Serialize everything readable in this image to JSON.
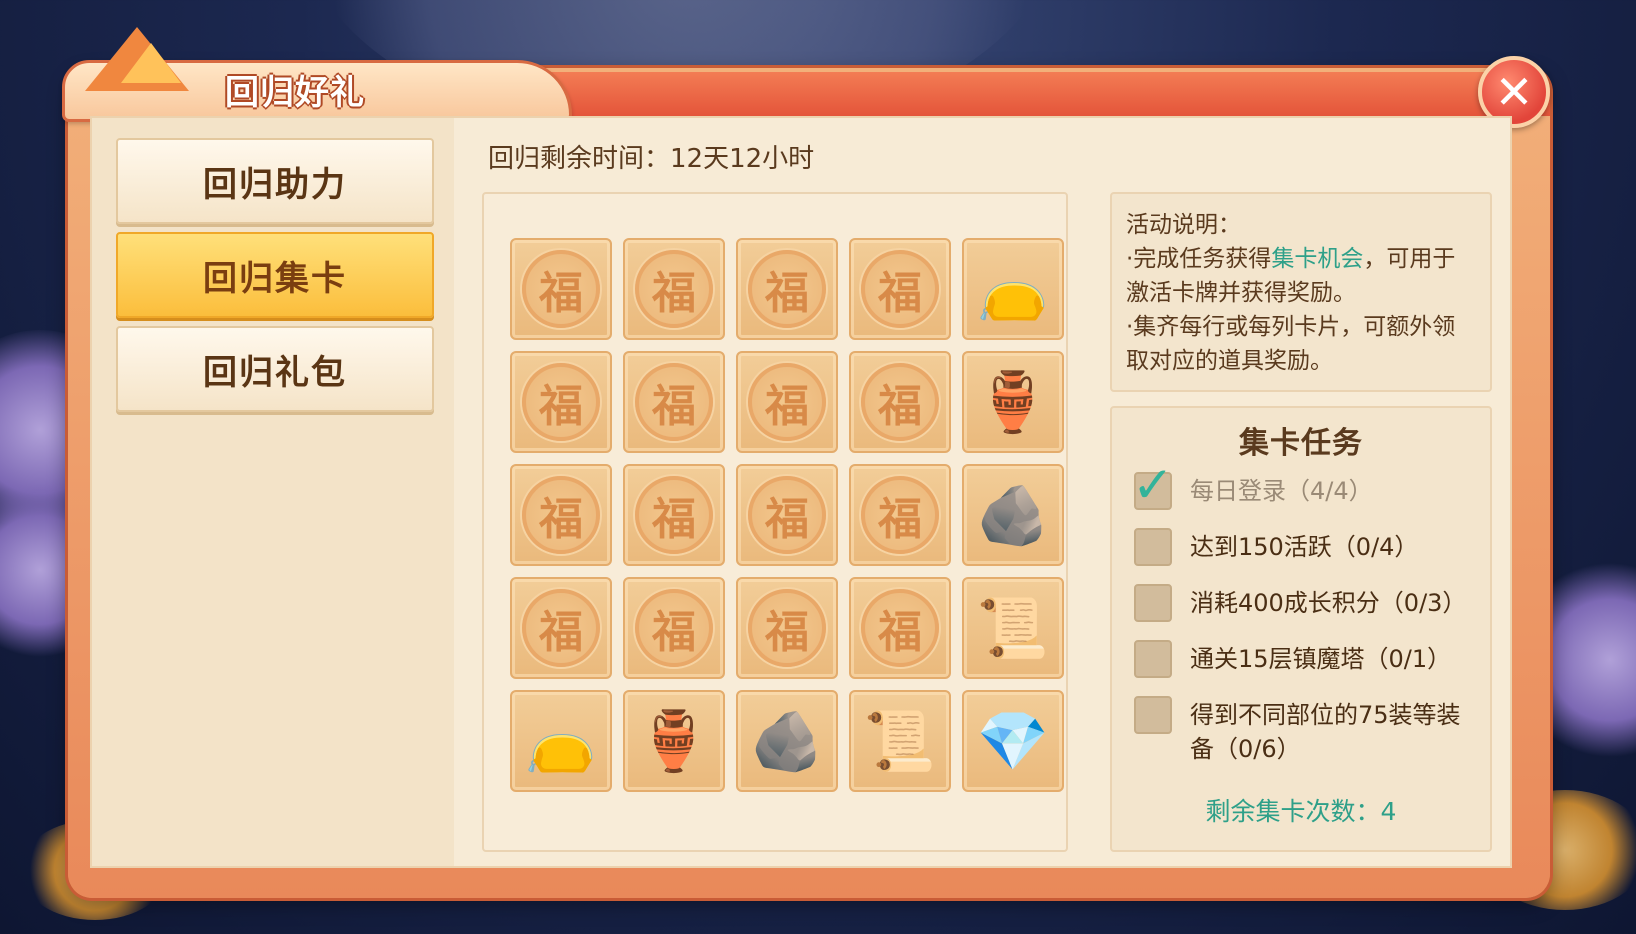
{
  "window": {
    "title": "回归好礼",
    "close_icon": "close-icon"
  },
  "sidebar": {
    "items": [
      {
        "label": "回归助力",
        "active": false
      },
      {
        "label": "回归集卡",
        "active": true
      },
      {
        "label": "回归礼包",
        "active": false
      }
    ]
  },
  "timer": {
    "text": "回归剩余时间：12天12小时"
  },
  "card_grid": {
    "card_char": "福",
    "rows": [
      [
        "fu",
        "fu",
        "fu",
        "fu",
        "blue-bag"
      ],
      [
        "fu",
        "fu",
        "fu",
        "fu",
        "orange-pot"
      ],
      [
        "fu",
        "fu",
        "fu",
        "fu",
        "stone"
      ],
      [
        "fu",
        "fu",
        "fu",
        "fu",
        "scroll"
      ],
      [
        "blue-bag",
        "orange-pot",
        "stone",
        "scroll",
        "crystal"
      ]
    ]
  },
  "description": {
    "heading": "活动说明：",
    "line1_prefix": "·完成任务获得",
    "line1_highlight": "集卡机会",
    "line1_suffix": "，可用于激活卡牌并获得奖励。",
    "line2": "·集齐每行或每列卡片，可额外领取对应的道具奖励。"
  },
  "tasks": {
    "title": "集卡任务",
    "items": [
      {
        "label": "每日登录（4/4）",
        "done": true
      },
      {
        "label": "达到150活跃（0/4）",
        "done": false
      },
      {
        "label": "消耗400成长积分（0/3）",
        "done": false
      },
      {
        "label": "通关15层镇魔塔（0/1）",
        "done": false
      },
      {
        "label": "得到不同部位的75装等装备（0/6）",
        "done": false
      }
    ],
    "remaining": "剩余集卡次数：4"
  },
  "colors": {
    "accent_teal": "#2ea089",
    "header_red": "#e4553a",
    "active_tab": "#fbbe3c"
  }
}
